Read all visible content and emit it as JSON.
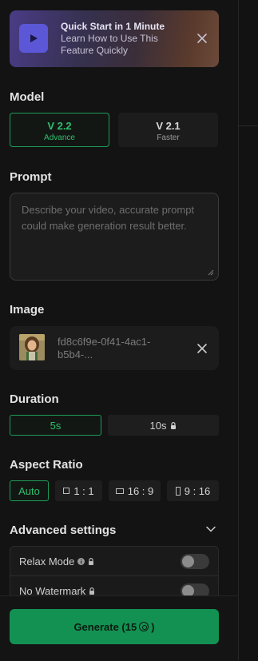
{
  "banner": {
    "title": "Quick Start in 1 Minute",
    "subtitle": "Learn How to Use This Feature Quickly"
  },
  "model": {
    "heading": "Model",
    "options": [
      {
        "name": "V 2.2",
        "desc": "Advance",
        "selected": true
      },
      {
        "name": "V 2.1",
        "desc": "Faster",
        "selected": false
      }
    ]
  },
  "prompt": {
    "heading": "Prompt",
    "value": "",
    "placeholder": "Describe your video, accurate prompt could make generation result better."
  },
  "image": {
    "heading": "Image",
    "filename": "fd8c6f9e-0f41-4ac1-b5b4-..."
  },
  "duration": {
    "heading": "Duration",
    "options": [
      {
        "label": "5s",
        "selected": true,
        "locked": false
      },
      {
        "label": "10s",
        "selected": false,
        "locked": true
      }
    ]
  },
  "aspect_ratio": {
    "heading": "Aspect Ratio",
    "options": [
      {
        "label": "Auto",
        "selected": true,
        "icon": "none"
      },
      {
        "label": "1 : 1",
        "selected": false,
        "icon": "square-icon"
      },
      {
        "label": "16 : 9",
        "selected": false,
        "icon": "landscape-icon"
      },
      {
        "label": "9 : 16",
        "selected": false,
        "icon": "portrait-icon"
      }
    ]
  },
  "advanced": {
    "heading": "Advanced settings",
    "relax_mode": {
      "label": "Relax Mode",
      "enabled": false
    },
    "no_watermark": {
      "label": "No Watermark",
      "enabled": false
    }
  },
  "generate": {
    "label": "Generate (15",
    "suffix": ")",
    "cost": 15
  },
  "colors": {
    "accent": "#1f9b5a",
    "generate_bg": "#139152",
    "panel_bg": "#131313"
  }
}
